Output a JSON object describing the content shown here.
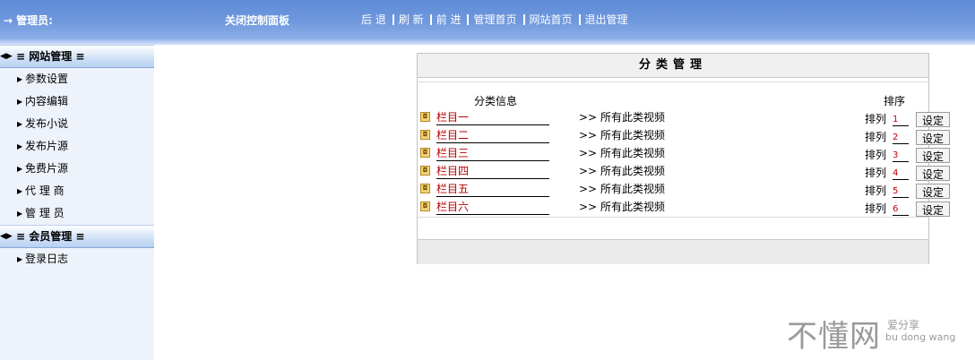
{
  "topbar": {
    "admin_arrow": "→",
    "admin_label": "管理员:",
    "close_panel": "关闭控制面板",
    "nav": [
      "后 退",
      "刷 新",
      "前 进",
      "管理首页",
      "网站首页",
      "退出管理"
    ]
  },
  "sidebar": {
    "groups": [
      {
        "icon": "◀▶",
        "title": "≡ 网站管理 ≡",
        "items": [
          "参数设置",
          "内容编辑",
          "发布小说",
          "发布片源",
          "免费片源",
          "代 理 商",
          "管 理 员"
        ]
      },
      {
        "icon": "◀▶",
        "title": "≡ 会员管理 ≡",
        "items": [
          "登录日志"
        ]
      }
    ],
    "item_icon": "▶"
  },
  "panel": {
    "title": "分类管理",
    "col_info": "分类信息",
    "col_sort": "排序",
    "link_prefix": ">>",
    "link_text": "所有此类视频",
    "sort_label": "排列",
    "button_label": "设定",
    "rows": [
      {
        "name": "栏目一",
        "order": "1"
      },
      {
        "name": "栏目二",
        "order": "2"
      },
      {
        "name": "栏目三",
        "order": "3"
      },
      {
        "name": "栏目四",
        "order": "4"
      },
      {
        "name": "栏目五",
        "order": "5"
      },
      {
        "name": "栏目六",
        "order": "6"
      }
    ]
  },
  "watermark": {
    "main": "不懂网",
    "sub1": "爱分享",
    "sub2": "bu dong wang"
  },
  "colors": {
    "topbar": "#6f98dd",
    "sidebar_bg": "#eef3fb",
    "category_name": "#b40000",
    "sort_value": "#c00000"
  }
}
